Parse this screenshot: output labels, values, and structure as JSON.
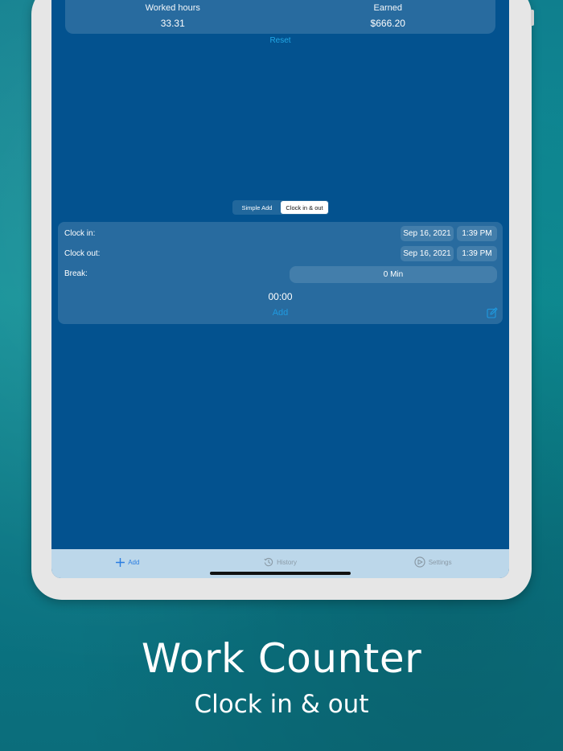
{
  "summary": {
    "worked_label": "Worked hours",
    "worked_value": "33.31",
    "earned_label": "Earned",
    "earned_value": "$666.20",
    "reset_label": "Reset"
  },
  "mode": {
    "options": [
      "Simple Add",
      "Clock in & out"
    ],
    "selected": "Clock in & out"
  },
  "form": {
    "clock_in_label": "Clock in:",
    "clock_in_date": "Sep 16, 2021",
    "clock_in_time": "1:39 PM",
    "clock_out_label": "Clock out:",
    "clock_out_date": "Sep 16, 2021",
    "clock_out_time": "1:39 PM",
    "break_label": "Break:",
    "break_value": "0 Min",
    "duration": "00:00",
    "add_label": "Add"
  },
  "tabbar": {
    "items": [
      {
        "label": "Add",
        "icon": "plus-icon",
        "active": true
      },
      {
        "label": "History",
        "icon": "history-icon",
        "active": false
      },
      {
        "label": "Settings",
        "icon": "settings-icon",
        "active": false
      }
    ]
  },
  "promo": {
    "title": "Work Counter",
    "subtitle": "Clock in & out"
  },
  "colors": {
    "screen_bg": "#03528f",
    "accent": "#2a7de1",
    "link": "#23a8e6",
    "tabbar_bg": "#bcd7ea"
  }
}
